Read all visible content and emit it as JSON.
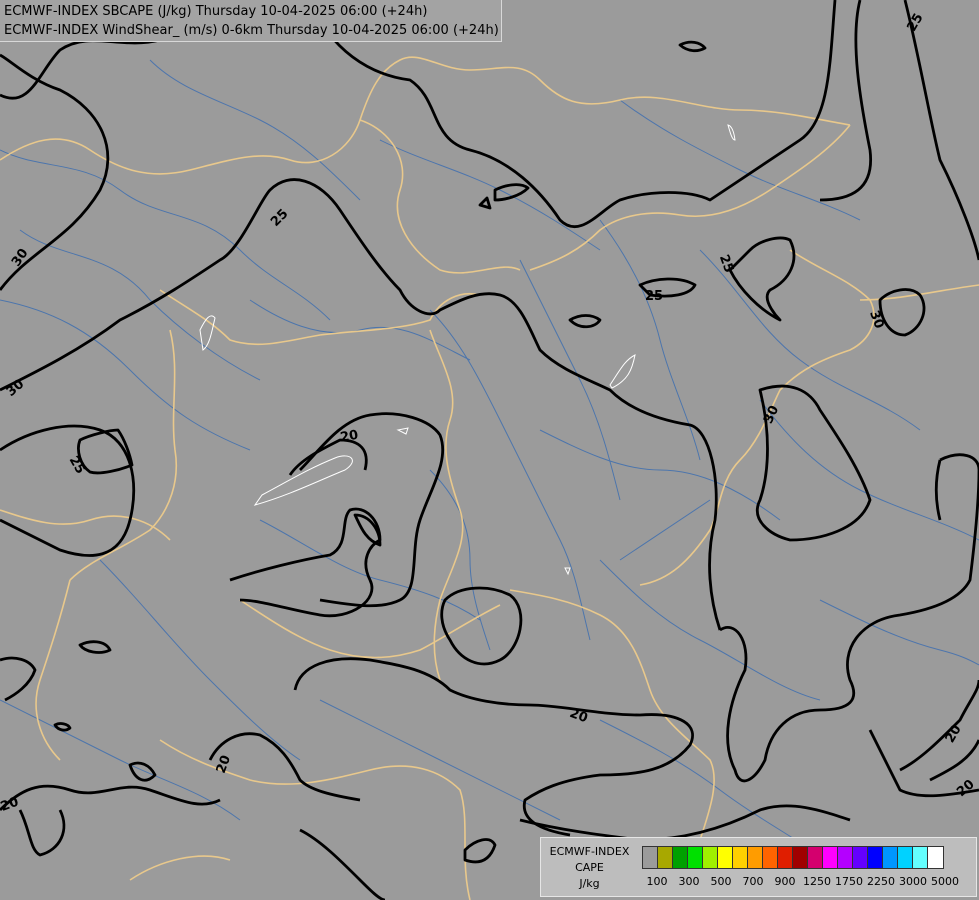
{
  "header": {
    "line1": "ECMWF-INDEX SBCAPE (J/kg) Thursday 10-04-2025 06:00 (+24h)",
    "line2": "ECMWF-INDEX WindShear_ (m/s) 0-6km Thursday 10-04-2025 06:00 (+24h)"
  },
  "legend": {
    "title_line1": "ECMWF-INDEX",
    "title_line2": "CAPE",
    "title_line3": "J/kg",
    "swatch_colors": [
      "#9b9b9b",
      "#a8a800",
      "#00a000",
      "#00e000",
      "#a0f000",
      "#ffff00",
      "#ffd000",
      "#ff9c00",
      "#ff6400",
      "#e01e00",
      "#a00000",
      "#d4006e",
      "#ff00ff",
      "#b400ff",
      "#6400ff",
      "#0000ff",
      "#0096ff",
      "#00d2ff",
      "#64ffff",
      "#ffffff"
    ],
    "tick_labels": [
      "100",
      "300",
      "500",
      "700",
      "900",
      "1250",
      "1750",
      "2250",
      "3000",
      "5000"
    ]
  },
  "map": {
    "contour_labels": [
      "25",
      "30",
      "30",
      "25",
      "25",
      "20",
      "25",
      "30",
      "30",
      "20",
      "20",
      "20",
      "20",
      "20",
      "30",
      "25"
    ],
    "colors": {
      "background": "#9b9b9b",
      "border": "#e8c88c",
      "river": "#3f6fb0",
      "contour": "#000000",
      "cape_outline": "#ffffff"
    }
  }
}
